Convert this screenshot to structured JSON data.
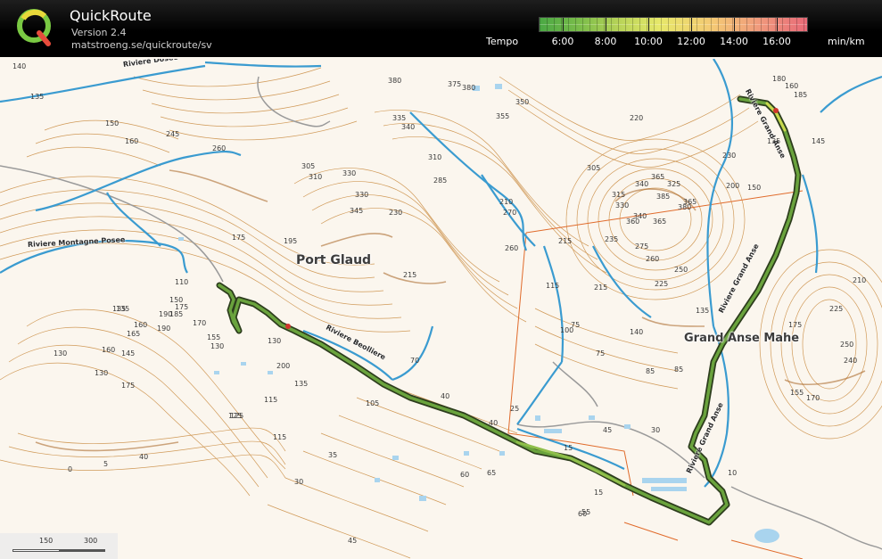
{
  "app": {
    "title": "QuickRoute",
    "version": "Version 2.4",
    "url": "matstroeng.se/quickroute/sv"
  },
  "legend": {
    "label": "Tempo",
    "unit": "min/km",
    "ticks": [
      "6:00",
      "8:00",
      "10:00",
      "12:00",
      "14:00",
      "16:00"
    ],
    "colors": {
      "fast": "#4aa844",
      "mid": "#e7e86a",
      "slow": "#e86a78"
    }
  },
  "map": {
    "places": {
      "port_glaud": "Port Glaud",
      "grand_anse": "Grand Anse Mahe"
    },
    "rivers": {
      "dosee": "Riviere Dosee",
      "montagne_posee": "Riviere Montagne Posee",
      "beolliere": "Riviere Beolliere",
      "grand_anse": "Riviere Grand Anse",
      "grand_anse_upper": "Riviere Grand Anse",
      "grand_anse_lower": "Riviere Grand Anse"
    },
    "contours": [
      "140",
      "135",
      "150",
      "160",
      "245",
      "260",
      "305",
      "310",
      "330",
      "380",
      "330",
      "345",
      "335",
      "340",
      "350",
      "375",
      "380",
      "355",
      "310",
      "285",
      "270",
      "220",
      "305",
      "315",
      "330",
      "340",
      "365",
      "325",
      "385",
      "380",
      "340",
      "360",
      "365",
      "365",
      "275",
      "260",
      "250",
      "230",
      "235",
      "225",
      "215",
      "200",
      "215",
      "190",
      "180",
      "135",
      "130",
      "175",
      "195",
      "175",
      "215",
      "200",
      "210",
      "230",
      "260",
      "150",
      "135",
      "185",
      "160",
      "190",
      "165",
      "160",
      "145",
      "130",
      "175",
      "130",
      "125",
      "155",
      "170",
      "130",
      "135",
      "115",
      "105",
      "110",
      "70",
      "40",
      "85",
      "75",
      "75",
      "40",
      "30",
      "45",
      "15",
      "10",
      "25",
      "15",
      "125",
      "115",
      "40",
      "0",
      "5",
      "35",
      "30",
      "60",
      "65",
      "55",
      "45",
      "135",
      "140",
      "115",
      "85",
      "150",
      "135",
      "250",
      "240",
      "225",
      "210",
      "175",
      "155",
      "170",
      "145",
      "160",
      "185",
      "100",
      "60"
    ],
    "scale": {
      "left": "150",
      "right": "300"
    }
  }
}
